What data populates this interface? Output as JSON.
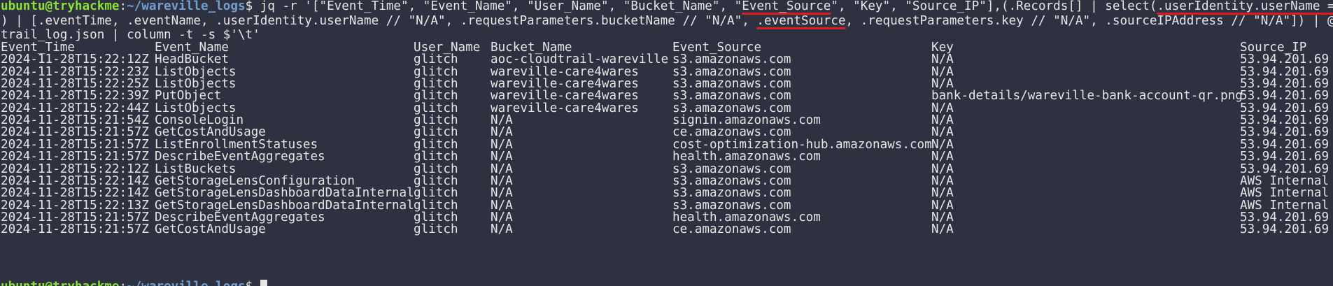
{
  "terminal": {
    "prompt": {
      "user": "ubuntu@tryhackme",
      "sep": ":",
      "path": "~/wareville_logs",
      "symbol": "$ "
    },
    "command": {
      "part1": "jq -r '[\"Event_Time\", \"Event_Name\", \"User_Name\", \"Bucket_Name\", \"",
      "hl1": "Event_Source",
      "part2": "\", \"Key\", \"Source_IP\"],(.Records[] | select(",
      "hl2": ".userIdentity.userName == \"glitch\"",
      "line2a": ") | [.eventTime, .eventName, .userIdentity.userName // \"N/A\", .requestParameters.bucketName // \"N/A\", ",
      "hl3": ".eventSource",
      "line2b": ", .requestParameters.key // \"N/A\", .sourceIPAddress // \"N/A\"]) | @tsv' cloud",
      "line3": "trail_log.json | column -t -s $'\\t'"
    },
    "header": [
      "Event_Time",
      "Event_Name",
      "User_Name",
      "Bucket_Name",
      "Event_Source",
      "Key",
      "Source_IP"
    ],
    "rows": [
      [
        "2024-11-28T15:22:12Z",
        "HeadBucket",
        "glitch",
        "aoc-cloudtrail-wareville",
        "s3.amazonaws.com",
        "N/A",
        "53.94.201.69"
      ],
      [
        "2024-11-28T15:22:23Z",
        "ListObjects",
        "glitch",
        "wareville-care4wares",
        "s3.amazonaws.com",
        "N/A",
        "53.94.201.69"
      ],
      [
        "2024-11-28T15:22:25Z",
        "ListObjects",
        "glitch",
        "wareville-care4wares",
        "s3.amazonaws.com",
        "N/A",
        "53.94.201.69"
      ],
      [
        "2024-11-28T15:22:39Z",
        "PutObject",
        "glitch",
        "wareville-care4wares",
        "s3.amazonaws.com",
        "bank-details/wareville-bank-account-qr.png",
        "53.94.201.69"
      ],
      [
        "2024-11-28T15:22:44Z",
        "ListObjects",
        "glitch",
        "wareville-care4wares",
        "s3.amazonaws.com",
        "N/A",
        "53.94.201.69"
      ],
      [
        "2024-11-28T15:21:54Z",
        "ConsoleLogin",
        "glitch",
        "N/A",
        "signin.amazonaws.com",
        "N/A",
        "53.94.201.69"
      ],
      [
        "2024-11-28T15:21:57Z",
        "GetCostAndUsage",
        "glitch",
        "N/A",
        "ce.amazonaws.com",
        "N/A",
        "53.94.201.69"
      ],
      [
        "2024-11-28T15:21:57Z",
        "ListEnrollmentStatuses",
        "glitch",
        "N/A",
        "cost-optimization-hub.amazonaws.com",
        "N/A",
        "53.94.201.69"
      ],
      [
        "2024-11-28T15:21:57Z",
        "DescribeEventAggregates",
        "glitch",
        "N/A",
        "health.amazonaws.com",
        "N/A",
        "53.94.201.69"
      ],
      [
        "2024-11-28T15:22:12Z",
        "ListBuckets",
        "glitch",
        "N/A",
        "s3.amazonaws.com",
        "N/A",
        "53.94.201.69"
      ],
      [
        "2024-11-28T15:22:14Z",
        "GetStorageLensConfiguration",
        "glitch",
        "N/A",
        "s3.amazonaws.com",
        "N/A",
        "AWS Internal"
      ],
      [
        "2024-11-28T15:22:14Z",
        "GetStorageLensDashboardDataInternal",
        "glitch",
        "N/A",
        "s3.amazonaws.com",
        "N/A",
        "AWS Internal"
      ],
      [
        "2024-11-28T15:22:13Z",
        "GetStorageLensDashboardDataInternal",
        "glitch",
        "N/A",
        "s3.amazonaws.com",
        "N/A",
        "AWS Internal"
      ],
      [
        "2024-11-28T15:21:57Z",
        "DescribeEventAggregates",
        "glitch",
        "N/A",
        "health.amazonaws.com",
        "N/A",
        "53.94.201.69"
      ],
      [
        "2024-11-28T15:21:57Z",
        "GetCostAndUsage",
        "glitch",
        "N/A",
        "ce.amazonaws.com",
        "N/A",
        "53.94.201.69"
      ]
    ]
  }
}
